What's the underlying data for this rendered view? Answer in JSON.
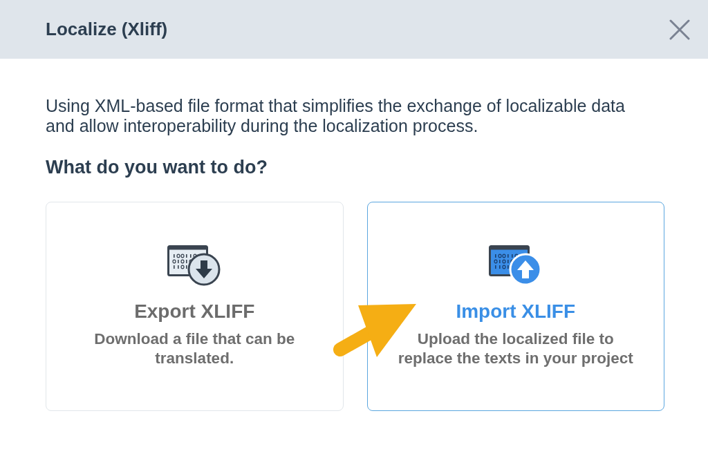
{
  "dialog": {
    "title": "Localize (Xliff)"
  },
  "description": "Using XML-based file format that simplifies the exchange of localizable data and allow interoperability during the localization process.",
  "question": "What do you want to do?",
  "options": [
    {
      "kind": "download",
      "title": "Export XLIFF",
      "description": "Download a file that can be translated.",
      "selected": false
    },
    {
      "kind": "upload",
      "title": "Import XLIFF",
      "description": "Upload the localized file to replace the texts in your project",
      "selected": true
    }
  ]
}
